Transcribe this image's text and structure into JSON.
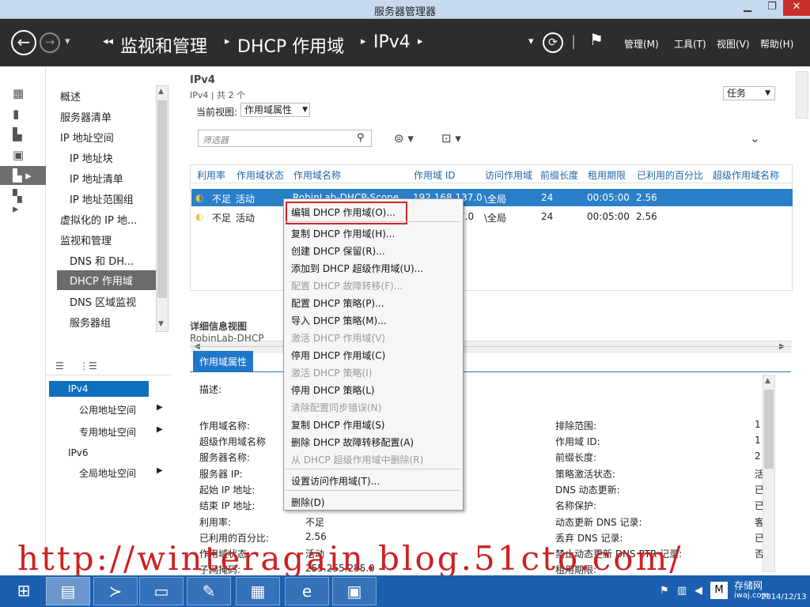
{
  "window": {
    "title": "服务器管理器"
  },
  "nav": {
    "crumbs": [
      "监视和管理",
      "DHCP 作用域",
      "IPv4"
    ],
    "menus": {
      "manage": "管理(M)",
      "tools": "工具(T)",
      "view": "视图(V)",
      "help": "帮助(H)"
    }
  },
  "tree": {
    "items": [
      "概述",
      "服务器清单",
      "IP 地址空间",
      "IP 地址块",
      "IP 地址清单",
      "IP 地址范围组",
      "虚拟化的 IP 地...",
      "监视和管理",
      "DNS 和 DH...",
      "DHCP 作用域",
      "DNS 区域监视",
      "服务器组"
    ]
  },
  "subtree": {
    "items": [
      "IPv4",
      "公用地址空间",
      "专用地址空间",
      "IPv6",
      "全局地址空间"
    ]
  },
  "main": {
    "title": "IPv4",
    "subtitle": "IPv4 | 共 2 个",
    "tasks_label": "任务",
    "current_view_label": "当前视图:",
    "current_view_value": "作用域属性",
    "filter_placeholder": "筛选器",
    "columns": [
      "利用率",
      "作用域状态",
      "作用域名称",
      "作用域 ID",
      "访问作用域",
      "前缀长度",
      "租用期限",
      "已利用的百分比",
      "超级作用域名称"
    ],
    "rows": [
      {
        "util": "不足",
        "state": "活动",
        "name": "RobinLab-DHCP-Scope",
        "id": "192.168.137.0",
        "access": "\\全局",
        "prefix": "24",
        "lease": "00:05:00",
        "pct": "2.56"
      },
      {
        "util": "不足",
        "state": "活动",
        "name": "",
        "id": "7.0",
        "access": "\\全局",
        "prefix": "24",
        "lease": "00:05:00",
        "pct": "2.56"
      }
    ],
    "details_title": "详细信息视图",
    "details_sub": "RobinLab-DHCP",
    "details_tab": "作用域属性",
    "desc_label": "描述:",
    "left_fields": [
      "作用域名称:",
      "超级作用域名称",
      "服务器名称:",
      "服务器 IP:",
      "起始 IP 地址:",
      "结束 IP 地址:",
      "利用率:",
      "已利用的百分比:",
      "作用域状态:",
      "子网掩码:"
    ],
    "left_values": [
      "",
      "",
      "",
      "",
      "",
      "",
      "不足",
      "2.56",
      "活动",
      "255.255.255.0"
    ],
    "right_fields": [
      "排除范围:",
      "作用域 ID:",
      "前缀长度:",
      "策略激活状态:",
      "DNS 动态更新:",
      "名称保护:",
      "动态更新 DNS 记录:",
      "丢弃 DNS 记录:",
      "禁止动态更新 DNS PTR 记录:",
      "租用期限:"
    ],
    "right_values": [
      "1",
      "1",
      "2",
      "活",
      "已",
      "已",
      "客",
      "已",
      "否",
      ""
    ]
  },
  "context_menu": {
    "items": [
      {
        "label": "编辑 DHCP 作用域(O)...",
        "disabled": false
      },
      {
        "label": "复制 DHCP 作用域(H)...",
        "disabled": false
      },
      {
        "label": "创建 DHCP 保留(R)...",
        "disabled": false
      },
      {
        "label": "添加到 DHCP 超级作用域(U)...",
        "disabled": false
      },
      {
        "label": "配置 DHCP 故障转移(F)...",
        "disabled": true
      },
      {
        "label": "配置 DHCP 策略(P)...",
        "disabled": false
      },
      {
        "label": "导入 DHCP 策略(M)...",
        "disabled": false
      },
      {
        "label": "激活 DHCP 作用域(V)",
        "disabled": true
      },
      {
        "label": "停用 DHCP 作用域(C)",
        "disabled": false
      },
      {
        "label": "激活 DHCP 策略(I)",
        "disabled": true
      },
      {
        "label": "停用 DHCP 策略(L)",
        "disabled": false
      },
      {
        "label": "清除配置同步错误(N)",
        "disabled": true
      },
      {
        "label": "复制 DHCP 作用域(S)",
        "disabled": false
      },
      {
        "label": "删除 DHCP 故障转移配置(A)",
        "disabled": false
      },
      {
        "label": "从 DHCP 超级作用域中删除(R)",
        "disabled": true
      },
      {
        "label": "设置访问作用域(T)...",
        "disabled": false
      },
      {
        "label": "删除(D)",
        "disabled": false
      }
    ]
  },
  "taskbar": {
    "clock": "2014/12/13",
    "badge": "存储网",
    "badge_sub": "iwaj.com"
  },
  "watermark": "http://winteragain.blog.51cto.com/"
}
